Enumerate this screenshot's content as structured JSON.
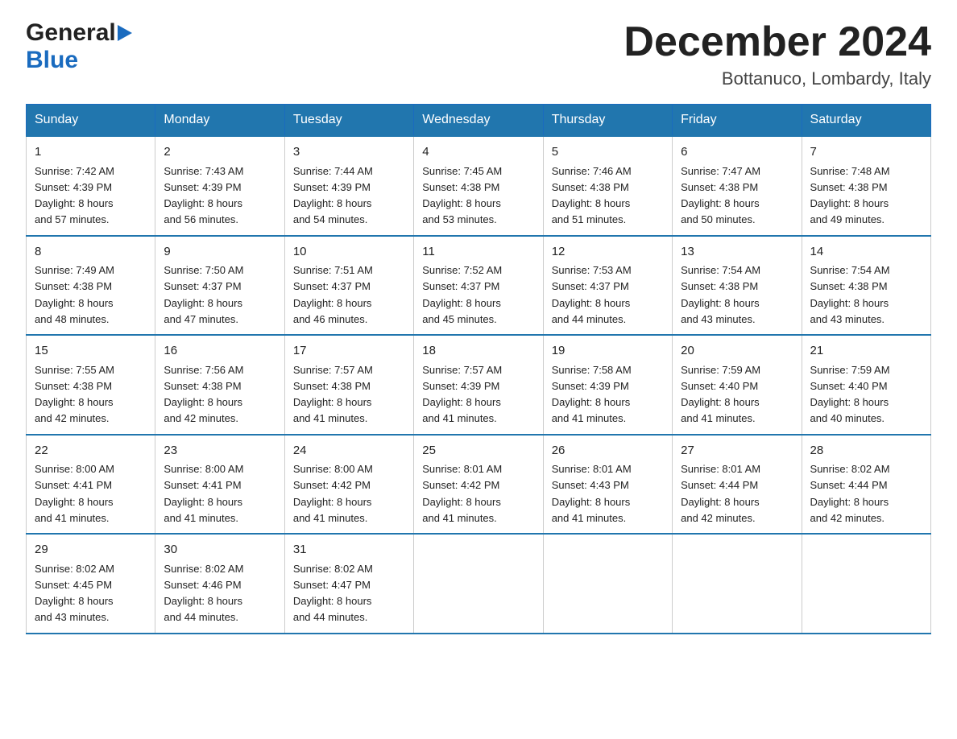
{
  "header": {
    "logo_general": "General",
    "logo_blue": "Blue",
    "month_title": "December 2024",
    "location": "Bottanuco, Lombardy, Italy"
  },
  "days_of_week": [
    "Sunday",
    "Monday",
    "Tuesday",
    "Wednesday",
    "Thursday",
    "Friday",
    "Saturday"
  ],
  "weeks": [
    [
      {
        "day": "1",
        "sunrise": "7:42 AM",
        "sunset": "4:39 PM",
        "daylight": "8 hours and 57 minutes."
      },
      {
        "day": "2",
        "sunrise": "7:43 AM",
        "sunset": "4:39 PM",
        "daylight": "8 hours and 56 minutes."
      },
      {
        "day": "3",
        "sunrise": "7:44 AM",
        "sunset": "4:39 PM",
        "daylight": "8 hours and 54 minutes."
      },
      {
        "day": "4",
        "sunrise": "7:45 AM",
        "sunset": "4:38 PM",
        "daylight": "8 hours and 53 minutes."
      },
      {
        "day": "5",
        "sunrise": "7:46 AM",
        "sunset": "4:38 PM",
        "daylight": "8 hours and 51 minutes."
      },
      {
        "day": "6",
        "sunrise": "7:47 AM",
        "sunset": "4:38 PM",
        "daylight": "8 hours and 50 minutes."
      },
      {
        "day": "7",
        "sunrise": "7:48 AM",
        "sunset": "4:38 PM",
        "daylight": "8 hours and 49 minutes."
      }
    ],
    [
      {
        "day": "8",
        "sunrise": "7:49 AM",
        "sunset": "4:38 PM",
        "daylight": "8 hours and 48 minutes."
      },
      {
        "day": "9",
        "sunrise": "7:50 AM",
        "sunset": "4:37 PM",
        "daylight": "8 hours and 47 minutes."
      },
      {
        "day": "10",
        "sunrise": "7:51 AM",
        "sunset": "4:37 PM",
        "daylight": "8 hours and 46 minutes."
      },
      {
        "day": "11",
        "sunrise": "7:52 AM",
        "sunset": "4:37 PM",
        "daylight": "8 hours and 45 minutes."
      },
      {
        "day": "12",
        "sunrise": "7:53 AM",
        "sunset": "4:37 PM",
        "daylight": "8 hours and 44 minutes."
      },
      {
        "day": "13",
        "sunrise": "7:54 AM",
        "sunset": "4:38 PM",
        "daylight": "8 hours and 43 minutes."
      },
      {
        "day": "14",
        "sunrise": "7:54 AM",
        "sunset": "4:38 PM",
        "daylight": "8 hours and 43 minutes."
      }
    ],
    [
      {
        "day": "15",
        "sunrise": "7:55 AM",
        "sunset": "4:38 PM",
        "daylight": "8 hours and 42 minutes."
      },
      {
        "day": "16",
        "sunrise": "7:56 AM",
        "sunset": "4:38 PM",
        "daylight": "8 hours and 42 minutes."
      },
      {
        "day": "17",
        "sunrise": "7:57 AM",
        "sunset": "4:38 PM",
        "daylight": "8 hours and 41 minutes."
      },
      {
        "day": "18",
        "sunrise": "7:57 AM",
        "sunset": "4:39 PM",
        "daylight": "8 hours and 41 minutes."
      },
      {
        "day": "19",
        "sunrise": "7:58 AM",
        "sunset": "4:39 PM",
        "daylight": "8 hours and 41 minutes."
      },
      {
        "day": "20",
        "sunrise": "7:59 AM",
        "sunset": "4:40 PM",
        "daylight": "8 hours and 41 minutes."
      },
      {
        "day": "21",
        "sunrise": "7:59 AM",
        "sunset": "4:40 PM",
        "daylight": "8 hours and 40 minutes."
      }
    ],
    [
      {
        "day": "22",
        "sunrise": "8:00 AM",
        "sunset": "4:41 PM",
        "daylight": "8 hours and 41 minutes."
      },
      {
        "day": "23",
        "sunrise": "8:00 AM",
        "sunset": "4:41 PM",
        "daylight": "8 hours and 41 minutes."
      },
      {
        "day": "24",
        "sunrise": "8:00 AM",
        "sunset": "4:42 PM",
        "daylight": "8 hours and 41 minutes."
      },
      {
        "day": "25",
        "sunrise": "8:01 AM",
        "sunset": "4:42 PM",
        "daylight": "8 hours and 41 minutes."
      },
      {
        "day": "26",
        "sunrise": "8:01 AM",
        "sunset": "4:43 PM",
        "daylight": "8 hours and 41 minutes."
      },
      {
        "day": "27",
        "sunrise": "8:01 AM",
        "sunset": "4:44 PM",
        "daylight": "8 hours and 42 minutes."
      },
      {
        "day": "28",
        "sunrise": "8:02 AM",
        "sunset": "4:44 PM",
        "daylight": "8 hours and 42 minutes."
      }
    ],
    [
      {
        "day": "29",
        "sunrise": "8:02 AM",
        "sunset": "4:45 PM",
        "daylight": "8 hours and 43 minutes."
      },
      {
        "day": "30",
        "sunrise": "8:02 AM",
        "sunset": "4:46 PM",
        "daylight": "8 hours and 44 minutes."
      },
      {
        "day": "31",
        "sunrise": "8:02 AM",
        "sunset": "4:47 PM",
        "daylight": "8 hours and 44 minutes."
      },
      null,
      null,
      null,
      null
    ]
  ],
  "labels": {
    "sunrise_prefix": "Sunrise: ",
    "sunset_prefix": "Sunset: ",
    "daylight_prefix": "Daylight: "
  }
}
